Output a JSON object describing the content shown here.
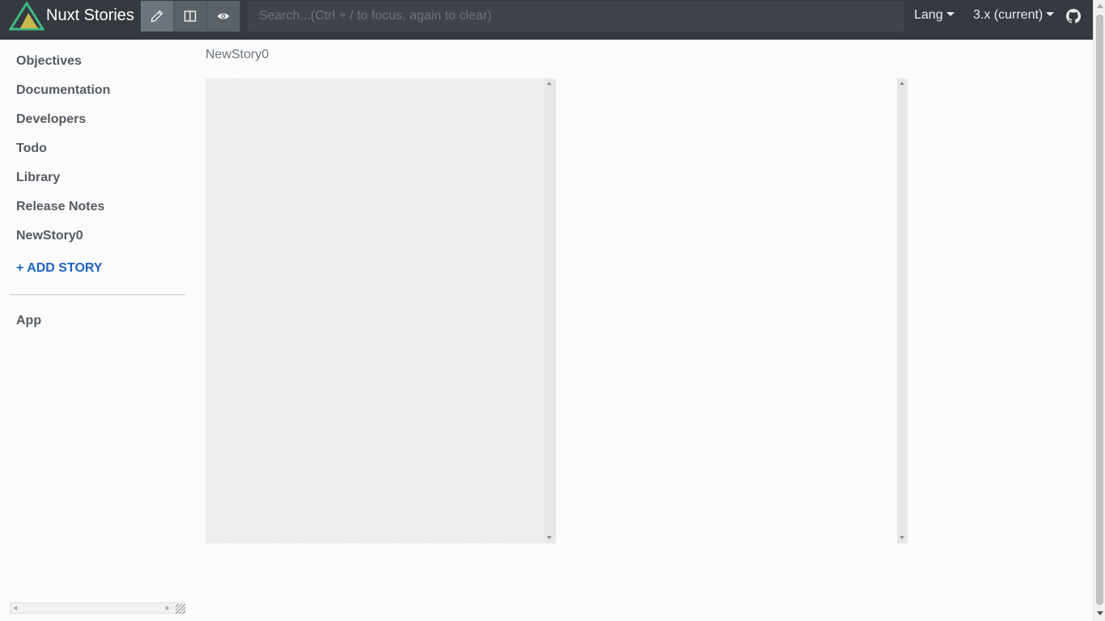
{
  "app": {
    "title": "Nuxt Stories",
    "logo_icon": "nuxt-logo-icon",
    "colors": {
      "navbar": "#343a40",
      "logo_green": "#41b883",
      "logo_yellow": "#c9b84b",
      "link_blue": "#1e62c0"
    }
  },
  "toolbar": {
    "modes": [
      {
        "icon": "pencil-icon",
        "state": "active"
      },
      {
        "icon": "split-view-icon",
        "state": "inactive"
      },
      {
        "icon": "eye-icon",
        "state": "inactive"
      }
    ],
    "search_placeholder": "Search...(Ctrl + / to focus, again to clear)",
    "lang_label": "Lang",
    "version_label": "3.x (current)",
    "github_icon": "github-icon"
  },
  "sidebar": {
    "items": [
      {
        "label": "Objectives"
      },
      {
        "label": "Documentation"
      },
      {
        "label": "Developers"
      },
      {
        "label": "Todo"
      },
      {
        "label": "Library"
      },
      {
        "label": "Release Notes"
      },
      {
        "label": "NewStory0"
      }
    ],
    "add_story_label": "+ ADD STORY",
    "secondary_items": [
      {
        "label": "App"
      }
    ]
  },
  "main": {
    "story_title": "NewStory0"
  }
}
